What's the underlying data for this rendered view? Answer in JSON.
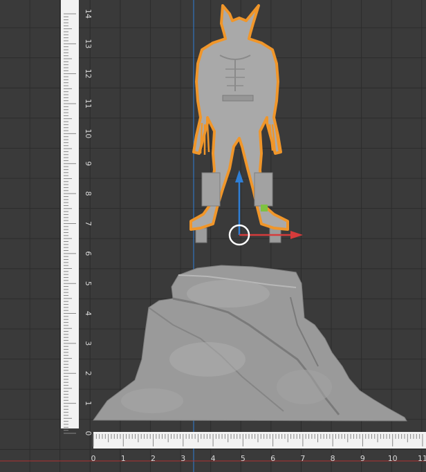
{
  "viewport": {
    "background": "#3a3a3a",
    "grid_color": "#2b2b2b",
    "axis_x_color": "#c0392b",
    "axis_y_color": "#2f7fd6"
  },
  "vertical_ruler": {
    "labels": [
      "0",
      "1",
      "2",
      "3",
      "4",
      "5",
      "6",
      "7",
      "8",
      "9",
      "10",
      "11",
      "12",
      "13",
      "14"
    ]
  },
  "horizontal_ruler": {
    "labels": [
      "0",
      "1",
      "2",
      "3",
      "4",
      "5",
      "6",
      "7",
      "8",
      "9",
      "10",
      "11"
    ]
  },
  "model": {
    "figure": "humanoid-figure-model",
    "base": "rock-base-model",
    "highlight_color": "#f0962a",
    "mesh_color": "#a9a9a9"
  },
  "gizmo": {
    "x_color": "#d63b3b",
    "y_color": "#2f7fd6",
    "z_handle_color": "#7fc241"
  }
}
